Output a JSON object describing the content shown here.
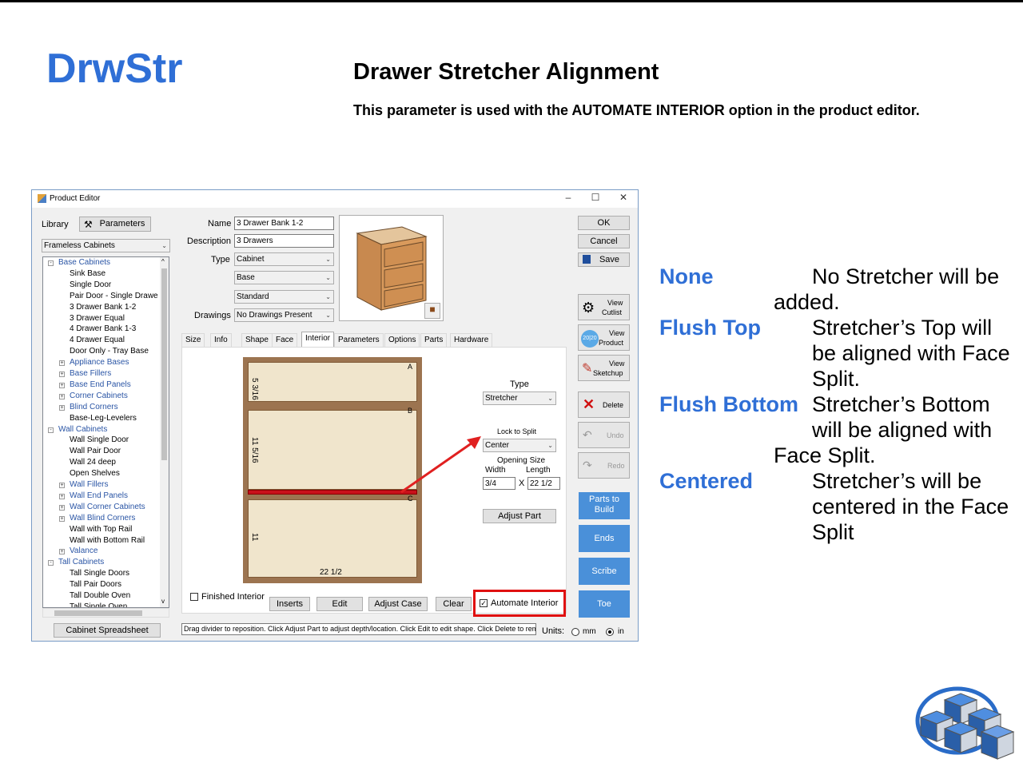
{
  "slide": {
    "title": "DrwStr",
    "heading": "Drawer Stretcher Alignment",
    "subtitle": "This parameter is used with the AUTOMATE INTERIOR option in the product editor."
  },
  "window": {
    "title": "Product Editor",
    "library_label": "Library",
    "parameters_button": "Parameters",
    "library_combo": "Frameless Cabinets",
    "name_label": "Name",
    "name_value": "3 Drawer Bank 1-2",
    "description_label": "Description",
    "description_value": "3 Drawers",
    "type_label": "Type",
    "type_value": "Cabinet",
    "type2_value": "Base",
    "type3_value": "Standard",
    "drawings_label": "Drawings",
    "drawings_value": "No Drawings Present",
    "ok": "OK",
    "cancel": "Cancel",
    "save": "Save",
    "view_cutlist_1": "View",
    "view_cutlist_2": "Cutlist",
    "view_product_1": "View",
    "view_product_2": "Product",
    "view_sketchup_1": "View",
    "view_sketchup_2": "Sketchup",
    "delete": "Delete",
    "undo": "Undo",
    "redo": "Redo",
    "parts_to_build_1": "Parts to",
    "parts_to_build_2": "Build",
    "ends": "Ends",
    "scribe": "Scribe",
    "toe": "Toe",
    "cabinet_spreadsheet": "Cabinet Spreadsheet",
    "tabs": [
      "Size",
      "Info",
      "Shape",
      "Face",
      "Interior",
      "Parameters",
      "Options",
      "Parts",
      "Hardware"
    ],
    "interior": {
      "type_label": "Type",
      "type_value": "Stretcher",
      "lock_label": "Lock to Split",
      "lock_value": "Center",
      "opening_size_label": "Opening Size",
      "width_label": "Width",
      "length_label": "Length",
      "width_value": "3/4",
      "x_label": "X",
      "length_value": "22 1/2",
      "adjust_part": "Adjust Part",
      "finished_interior": "Finished Interior",
      "inserts": "Inserts",
      "edit": "Edit",
      "adjust_case": "Adjust Case",
      "clear": "Clear",
      "automate_interior": "Automate Interior",
      "dim_top": "5 3/16",
      "dim_middle": "11 5/16",
      "dim_bottom": "11",
      "dim_width": "22 1/2",
      "marker_a": "A",
      "marker_b": "B",
      "marker_c": "C"
    },
    "status_text": "Drag divider to reposition. Click Adjust Part to adjust depth/location. Click Edit to edit shape. Click Delete to remove this di",
    "units_label": "Units:",
    "unit_mm": "mm",
    "unit_in": "in",
    "tree": [
      {
        "label": "Base Cabinets",
        "kind": "cat",
        "level": 0,
        "exp": "-"
      },
      {
        "label": "Sink Base",
        "kind": "leaf",
        "level": 1
      },
      {
        "label": "Single Door",
        "kind": "leaf",
        "level": 1
      },
      {
        "label": "Pair Door - Single Drawe",
        "kind": "leaf",
        "level": 1
      },
      {
        "label": "3 Drawer Bank 1-2",
        "kind": "leaf",
        "level": 1
      },
      {
        "label": "3 Drawer Equal",
        "kind": "leaf",
        "level": 1
      },
      {
        "label": "4 Drawer Bank 1-3",
        "kind": "leaf",
        "level": 1
      },
      {
        "label": "4 Drawer Equal",
        "kind": "leaf",
        "level": 1
      },
      {
        "label": "Door Only - Tray Base",
        "kind": "leaf",
        "level": 1
      },
      {
        "label": "Appliance Bases",
        "kind": "cat",
        "level": 1,
        "exp": "+"
      },
      {
        "label": "Base Fillers",
        "kind": "cat",
        "level": 1,
        "exp": "+"
      },
      {
        "label": "Base End Panels",
        "kind": "cat",
        "level": 1,
        "exp": "+"
      },
      {
        "label": "Corner Cabinets",
        "kind": "cat",
        "level": 1,
        "exp": "+"
      },
      {
        "label": "Blind Corners",
        "kind": "cat",
        "level": 1,
        "exp": "+"
      },
      {
        "label": "Base-Leg-Levelers",
        "kind": "leaf",
        "level": 1
      },
      {
        "label": "Wall Cabinets",
        "kind": "cat",
        "level": 0,
        "exp": "-"
      },
      {
        "label": "Wall Single Door",
        "kind": "leaf",
        "level": 1
      },
      {
        "label": "Wall Pair Door",
        "kind": "leaf",
        "level": 1
      },
      {
        "label": "Wall 24 deep",
        "kind": "leaf",
        "level": 1
      },
      {
        "label": "Open Shelves",
        "kind": "leaf",
        "level": 1
      },
      {
        "label": "Wall Fillers",
        "kind": "cat",
        "level": 1,
        "exp": "+"
      },
      {
        "label": "Wall End Panels",
        "kind": "cat",
        "level": 1,
        "exp": "+"
      },
      {
        "label": "Wall Corner Cabinets",
        "kind": "cat",
        "level": 1,
        "exp": "+"
      },
      {
        "label": "Wall Blind Corners",
        "kind": "cat",
        "level": 1,
        "exp": "+"
      },
      {
        "label": "Wall with Top Rail",
        "kind": "leaf",
        "level": 1
      },
      {
        "label": "Wall with Bottom Rail",
        "kind": "leaf",
        "level": 1
      },
      {
        "label": "Valance",
        "kind": "cat",
        "level": 1,
        "exp": "+"
      },
      {
        "label": "Tall Cabinets",
        "kind": "cat",
        "level": 0,
        "exp": "-"
      },
      {
        "label": "Tall Single Doors",
        "kind": "leaf",
        "level": 1
      },
      {
        "label": "Tall Pair Doors",
        "kind": "leaf",
        "level": 1
      },
      {
        "label": "Tall Double Oven",
        "kind": "leaf",
        "level": 1
      },
      {
        "label": "Tall Single Oven",
        "kind": "leaf",
        "level": 1
      }
    ]
  },
  "options": {
    "none_key": "None",
    "none_desc_1": "No Stretcher will be",
    "none_desc_2": "added.",
    "flush_top_key": "Flush Top",
    "flush_top_desc_1": "Stretcher’s Top will",
    "flush_top_desc_2": "be aligned with Face",
    "flush_top_desc_3": "Split.",
    "flush_bottom_key": "Flush Bottom",
    "flush_bottom_desc_1": "Stretcher’s Bottom",
    "flush_bottom_desc_2": "will be aligned with",
    "flush_bottom_desc_3": "Face Split.",
    "centered_key": "Centered",
    "centered_desc_1": "Stretcher’s will be",
    "centered_desc_2": "centered in the Face",
    "centered_desc_3": "Split"
  }
}
